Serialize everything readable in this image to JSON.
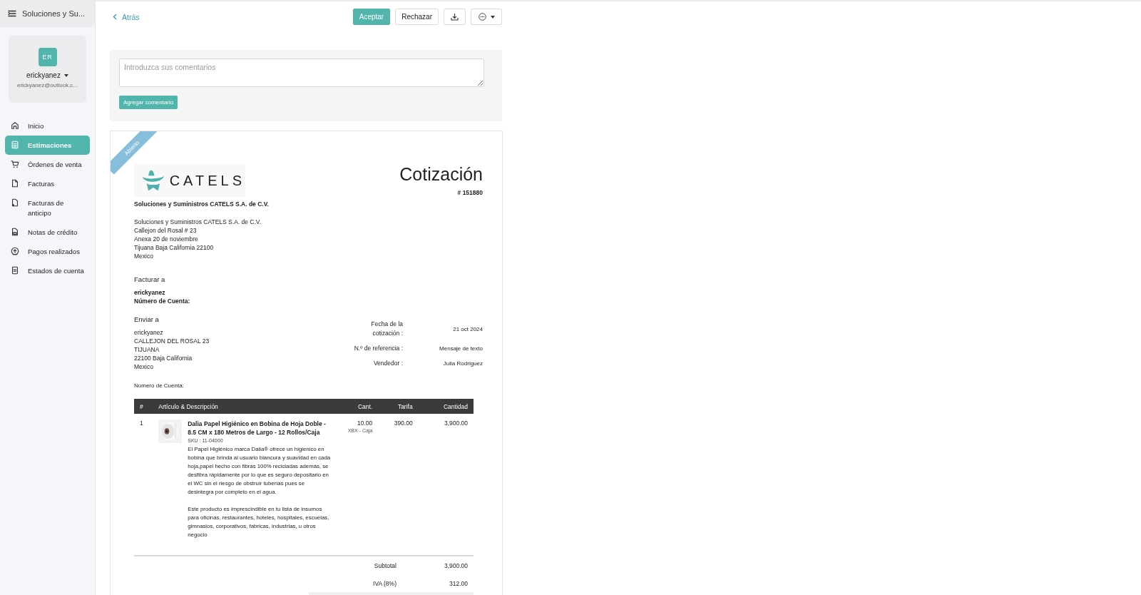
{
  "sidebar": {
    "org_name": "Soluciones y Su...",
    "profile": {
      "initials": "ER",
      "username": "erickyanez",
      "email": "erickyanez@outlook.c..."
    },
    "items": [
      {
        "label": "Inicio",
        "selected": false
      },
      {
        "label": "Estimaciones",
        "selected": true
      },
      {
        "label": "Órdenes de venta",
        "selected": false
      },
      {
        "label": "Facturas",
        "selected": false
      },
      {
        "label": "Facturas de anticipo",
        "selected": false
      },
      {
        "label": "Notas de crédito",
        "selected": false
      },
      {
        "label": "Pagos realizados",
        "selected": false
      },
      {
        "label": "Estados de cuenta",
        "selected": false
      }
    ]
  },
  "toolbar": {
    "back": "Atrás",
    "accept": "Aceptar",
    "reject": "Rechazar"
  },
  "comments": {
    "placeholder": "Introduzca sus comentarios",
    "button": "Agregar comentario"
  },
  "document": {
    "status": "Abierto",
    "logo_text": "CATELS",
    "title": "Cotización",
    "number": "# 151880",
    "company_name": "Soluciones y Suministros CATELS S.A. de C.V.",
    "company_address": [
      "Soluciones y Suministros CATELS S.A. de C.V.",
      "Callejon del Rosal # 23",
      "Anexa 20 de noviembre",
      "Tijuana Baja California 22100",
      "Mexico"
    ],
    "bill_to": {
      "heading": "Facturar a",
      "name": "erickyanez",
      "account": "Número de Cuenta:"
    },
    "ship_to": {
      "heading": "Enviar a",
      "lines": [
        "erickyanez",
        "CALLEJON DEL ROSAL 23",
        "TIJUANA",
        "22100 Baja California",
        "Mexico"
      ]
    },
    "meta": [
      {
        "label": "Fecha de la cotización :",
        "value": "21 oct 2024"
      },
      {
        "label": "N.º de referencia :",
        "value": "Mensaje de texto"
      },
      {
        "label": "Vendedor :",
        "value": "Julia Rodriguez"
      }
    ],
    "account_note": "Número de Cuenta:",
    "table": {
      "columns": [
        "#",
        "Artículo & Descripción",
        "Cant.",
        "Tarifa",
        "Cantidad"
      ],
      "rows": [
        {
          "index": "1",
          "title": "Dalia Papel Higiénico en Bobina de Hoja Doble - 8.5 CM x 180 Metros de Largo - 12 Rollos/Caja",
          "sku": "SKU : 11-04000",
          "description": [
            "El Papel Higiénico marca Dalia® ofrece un higienico en bobina que brinda al usuario blancura y suavidad en cada hoja,papel hecho con fibras 100% recicladas además, se desfibra rápidamente por lo que es seguro depositario en el WC sin el riesgo de obstruir tuberías pues se desintegra por completo en el agua.",
            "Este producto es imprescindible en tu lista de insumos para oficinas, restaurantes, hoteles, hospitales, escuelas, gimnasios, corporativos, fabricas, industrias, u otros negocio"
          ],
          "quantity": "10.00",
          "unit": "XBX - Caja",
          "rate": "390.00",
          "amount": "3,900.00"
        }
      ]
    },
    "totals": [
      {
        "label": "Subtotal",
        "value": "3,900.00"
      },
      {
        "label": "IVA (8%)",
        "value": "312.00"
      }
    ]
  }
}
